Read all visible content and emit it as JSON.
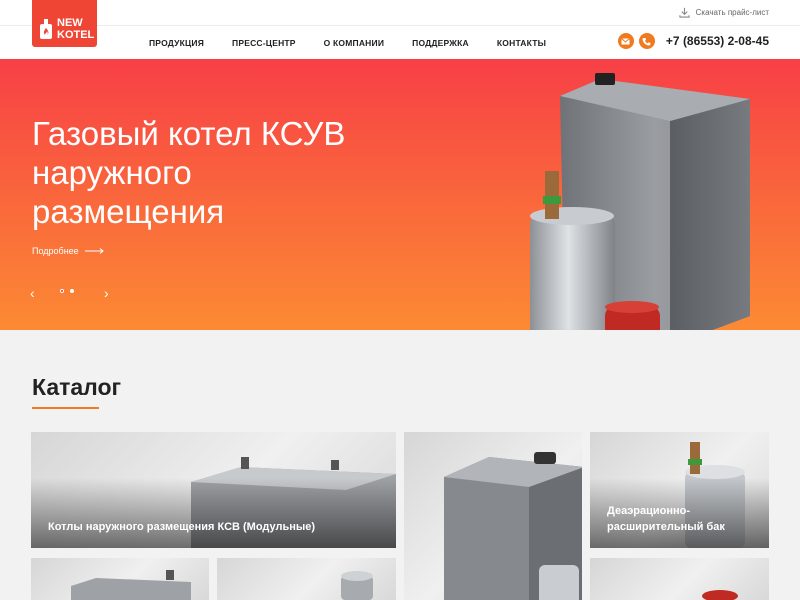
{
  "header": {
    "price_list": "Скачать прайс-лист",
    "logo_line1": "NEW",
    "logo_line2": "KOTEL",
    "phone": "+7 (86553) 2-08-45",
    "nav": [
      "ПРОДУКЦИЯ",
      "ПРЕСС-ЦЕНТР",
      "О КОМПАНИИ",
      "ПОДДЕРЖКА",
      "КОНТАКТЫ"
    ],
    "accent_color": "#f07a20",
    "logo_color": "#ef4534"
  },
  "hero": {
    "title": "Газовый котел КСУВ наружного размещения",
    "more": "Подробнее",
    "slide_count": 2,
    "active_slide": 1
  },
  "catalog": {
    "title": "Каталог",
    "cards": [
      {
        "label": "Котлы наружного размещения КСВ (Модульные)"
      },
      {
        "label": ""
      },
      {
        "label": "Деаэрационно-расширительный бак"
      }
    ]
  }
}
